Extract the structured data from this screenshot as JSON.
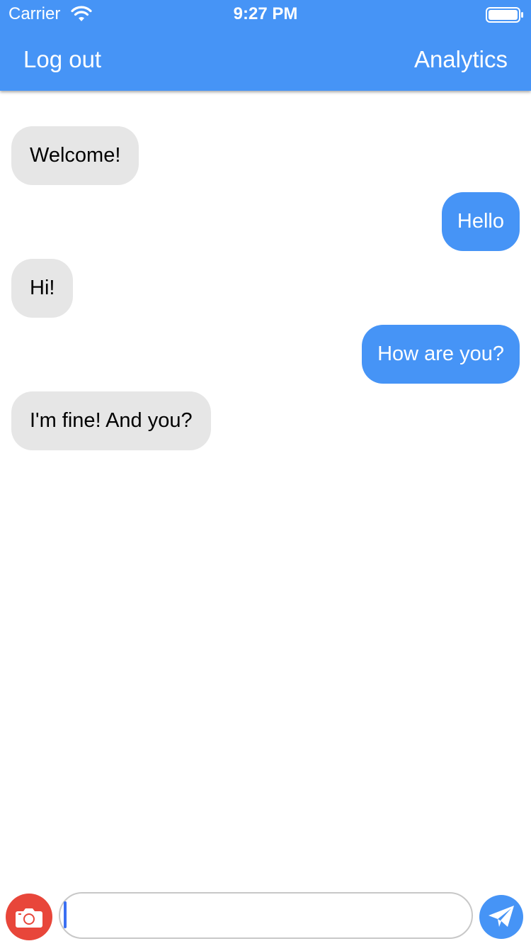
{
  "status_bar": {
    "carrier": "Carrier",
    "time": "9:27 PM",
    "wifi_icon": "wifi-icon",
    "battery_icon": "battery-icon"
  },
  "nav": {
    "left_label": "Log out",
    "right_label": "Analytics"
  },
  "messages": [
    {
      "direction": "incoming",
      "text": "Welcome!"
    },
    {
      "direction": "outgoing",
      "text": "Hello"
    },
    {
      "direction": "incoming",
      "text": "Hi!"
    },
    {
      "direction": "outgoing",
      "text": "How are you?"
    },
    {
      "direction": "incoming",
      "text": "I'm fine! And you?"
    }
  ],
  "composer": {
    "value": "",
    "placeholder": "",
    "camera_icon": "camera-icon",
    "send_icon": "send-icon"
  },
  "colors": {
    "accent": "#4694f6",
    "incoming_bubble": "#e6e6e6",
    "camera_button": "#e8463a"
  }
}
